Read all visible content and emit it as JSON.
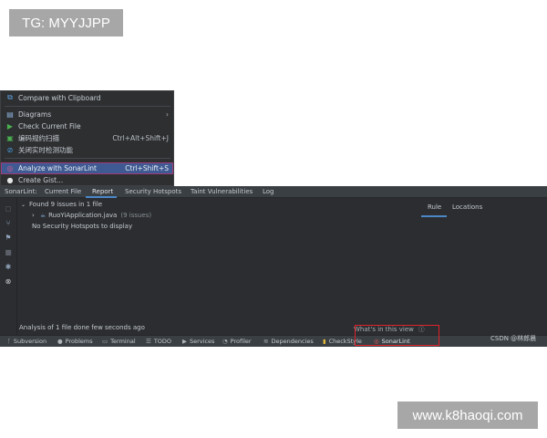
{
  "watermarks": {
    "top_left": "TG: MYYJJPP",
    "bottom_right": "www.k8haoqi.com",
    "csdn": "CSDN @林郎晨"
  },
  "context_menu": {
    "items": [
      {
        "label": "Compare with Clipboard",
        "shortcut": "",
        "icon": "compare-icon"
      },
      {
        "label": "Diagrams",
        "shortcut": "",
        "icon": "diagram-icon",
        "submenu": true
      },
      {
        "label": "Check Current File",
        "shortcut": "",
        "icon": "play-icon"
      },
      {
        "label": "编码规约扫描",
        "shortcut": "Ctrl+Alt+Shift+J",
        "icon": "scan-icon"
      },
      {
        "label": "关闭实时检测功能",
        "shortcut": "",
        "icon": "disable-icon"
      },
      {
        "label": "Analyze with SonarLint",
        "shortcut": "Ctrl+Shift+S",
        "icon": "sonarlint-icon"
      },
      {
        "label": "Create Gist...",
        "shortcut": "",
        "icon": "github-icon"
      }
    ]
  },
  "tool_window": {
    "tabs": [
      "SonarLint:",
      "Current File",
      "Report",
      "Security Hotspots",
      "Taint Vulnerabilities",
      "Log"
    ],
    "active_tab": "Report",
    "tree": {
      "summary": "Found 9 issues in 1 file",
      "file_name": "RuoYiApplication.java",
      "file_count": "(9 issues)",
      "no_hotspots": "No Security Hotspots to display"
    },
    "rule_panel_tabs": [
      "Rule",
      "Locations"
    ],
    "status": "Analysis of 1 file done few seconds ago",
    "whats_in_view": "What's in this view"
  },
  "bottom_bar": [
    {
      "label": "Subversion",
      "icon": "branch-icon"
    },
    {
      "label": "Problems",
      "icon": "info-icon"
    },
    {
      "label": "Terminal",
      "icon": "terminal-icon"
    },
    {
      "label": "TODO",
      "icon": "list-icon"
    },
    {
      "label": "Services",
      "icon": "services-icon"
    },
    {
      "label": "Profiler",
      "icon": "profiler-icon"
    },
    {
      "label": "Dependencies",
      "icon": "stack-icon"
    },
    {
      "label": "CheckStyle",
      "icon": "checkstyle-icon"
    },
    {
      "label": "SonarLint",
      "icon": "sonarlint-icon"
    }
  ],
  "colors": {
    "highlight_row": "#3f5a92",
    "highlight_outline": "#a13b7a",
    "annotation_red": "#e0222a",
    "accent_blue": "#4a88c7"
  }
}
